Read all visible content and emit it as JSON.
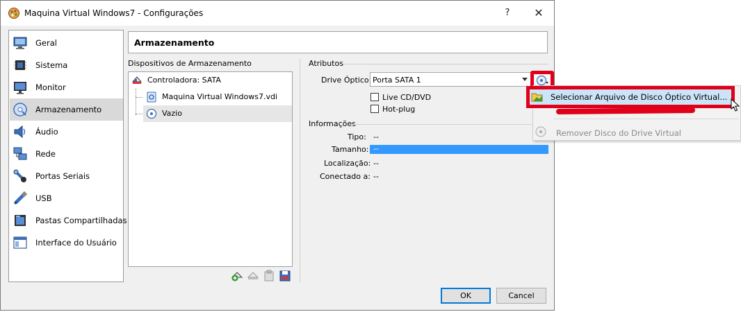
{
  "window": {
    "title": "Maquina Virtual Windows7 - Configurações",
    "help_glyph": "?",
    "close_glyph": "✕"
  },
  "sidebar": {
    "items": [
      {
        "label": "Geral",
        "icon": "monitor-icon"
      },
      {
        "label": "Sistema",
        "icon": "chip-icon"
      },
      {
        "label": "Monitor",
        "icon": "display-icon"
      },
      {
        "label": "Armazenamento",
        "icon": "storage-icon",
        "active": true
      },
      {
        "label": "Áudio",
        "icon": "speaker-icon"
      },
      {
        "label": "Rede",
        "icon": "network-icon"
      },
      {
        "label": "Portas Seriais",
        "icon": "serial-port-icon"
      },
      {
        "label": "USB",
        "icon": "usb-icon"
      },
      {
        "label": "Pastas Compartilhadas",
        "icon": "shared-folder-icon"
      },
      {
        "label": "Interface do Usuário",
        "icon": "ui-window-icon"
      }
    ]
  },
  "panel": {
    "title": "Armazenamento"
  },
  "storage": {
    "group_label": "Dispositivos de Armazenamento",
    "controller": "Controladora: SATA",
    "devices": [
      {
        "label": "Maquina Virtual Windows7.vdi",
        "icon": "hard-disk-icon"
      },
      {
        "label": "Vazio",
        "icon": "optical-disc-icon",
        "selected": true
      }
    ]
  },
  "attributes": {
    "group_label": "Atributos",
    "drive_label": "Drive Óptico:",
    "drive_value": "Porta SATA 1",
    "live_cd_label": "Live CD/DVD",
    "hotplug_label": "Hot-plug"
  },
  "info": {
    "group_label": "Informações",
    "rows": [
      {
        "label": "Tipo:",
        "value": "--"
      },
      {
        "label": "Tamanho:",
        "value": "--"
      },
      {
        "label": "Localização:",
        "value": "--"
      },
      {
        "label": "Conectado a:",
        "value": "--"
      }
    ]
  },
  "buttons": {
    "ok": "OK",
    "cancel": "Cancel"
  },
  "context_menu": {
    "items": [
      {
        "label": "Selecionar Arquivo de Disco Óptico Virtual...",
        "icon": "folder-open-icon"
      },
      {
        "label": "Remover Disco do Drive Virtual",
        "icon": "remove-disc-icon",
        "disabled": true
      }
    ]
  },
  "colors": {
    "highlight_red": "#e0001a",
    "selection_blue": "#3399ff",
    "menu_highlight": "#cce4f7"
  }
}
